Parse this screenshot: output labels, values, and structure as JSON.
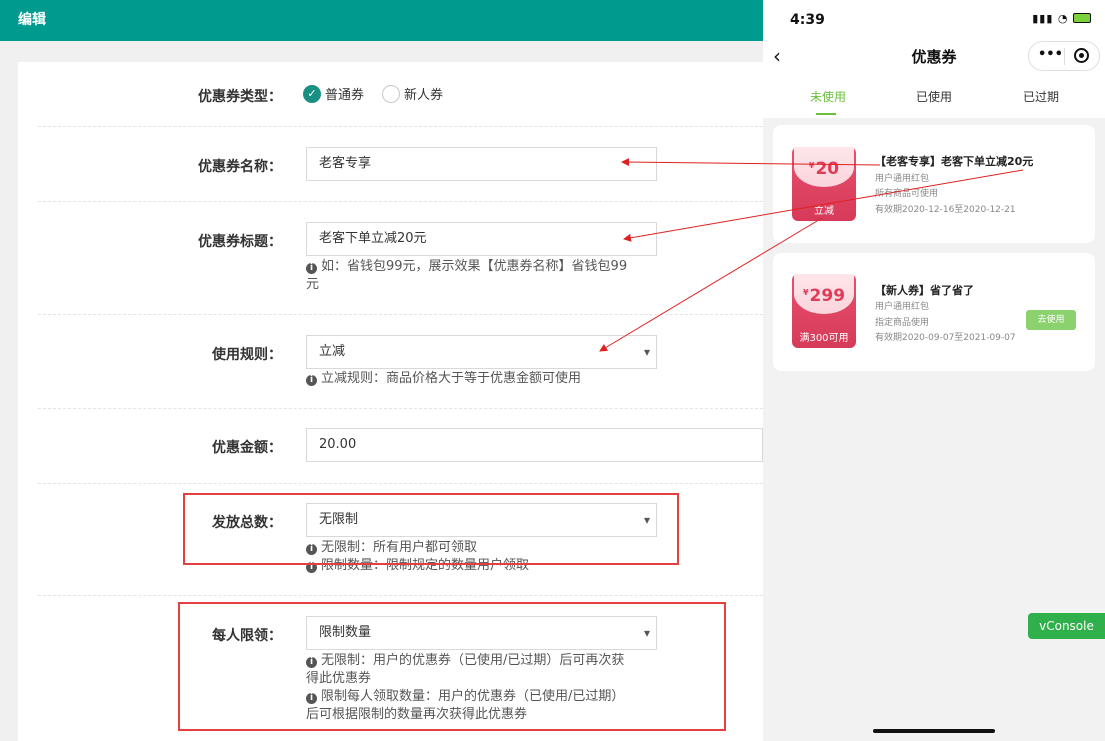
{
  "admin": {
    "header_title": "编辑",
    "coupon_type": {
      "label": "优惠券类型：",
      "options": [
        "普通券",
        "新人券"
      ],
      "selected": "普通券"
    },
    "coupon_name": {
      "label": "优惠券名称：",
      "value": "老客专享"
    },
    "coupon_title": {
      "label": "优惠券标题：",
      "value": "老客下单立减20元",
      "hint_line1": "如：省钱包99元，展示效果【优惠券名称】省钱包99",
      "hint_line2": "元"
    },
    "usage_rule": {
      "label": "使用规则：",
      "value": "立减",
      "hint": "立减规则：商品价格大于等于优惠金额可使用"
    },
    "amount": {
      "label": "优惠金额：",
      "value": "20.00"
    },
    "total_issue": {
      "label": "发放总数：",
      "value": "无限制",
      "hint1": "无限制：所有用户都可领取",
      "hint2": "限制数量：限制规定的数量用户领取"
    },
    "per_person": {
      "label": "每人限领：",
      "value": "限制数量",
      "hint1_line1": "无限制：用户的优惠券（已使用/已过期）后可再次获",
      "hint1_line2": "得此优惠券",
      "hint2_line1": "限制每人领取数量：用户的优惠券（已使用/已过期）",
      "hint2_line2": "后可根据限制的数量再次获得此优惠券"
    }
  },
  "phone": {
    "time": "4:39",
    "status_icons": "signal-icon wifi-icon battery-icon",
    "title": "优惠券",
    "tabs": [
      "未使用",
      "已使用",
      "已过期"
    ],
    "active_tab": "未使用",
    "coupons": [
      {
        "amount": "20",
        "currency": "¥",
        "badge": "立减",
        "title": "【老客专享】老客下单立减20元",
        "line1": "用户通用红包",
        "line2": "所有商品可使用",
        "validity": "有效期2020-12-16至2020-12-21"
      },
      {
        "amount": "299",
        "currency": "¥",
        "badge": "满300可用",
        "title": "【新人券】省了省了",
        "line1": "用户通用红包",
        "line2": "指定商品使用",
        "validity": "有效期2020-09-07至2021-09-07",
        "button": "去使用"
      }
    ],
    "vconsole": "vConsole"
  },
  "colors": {
    "header": "#009a8e",
    "highlight_box": "#e53f3f",
    "arrow": "#e02020",
    "tab_active": "#6cbf3c",
    "ticket": "#e23b5a",
    "use_button": "#8bd26f",
    "vconsole": "#2fb04a"
  }
}
